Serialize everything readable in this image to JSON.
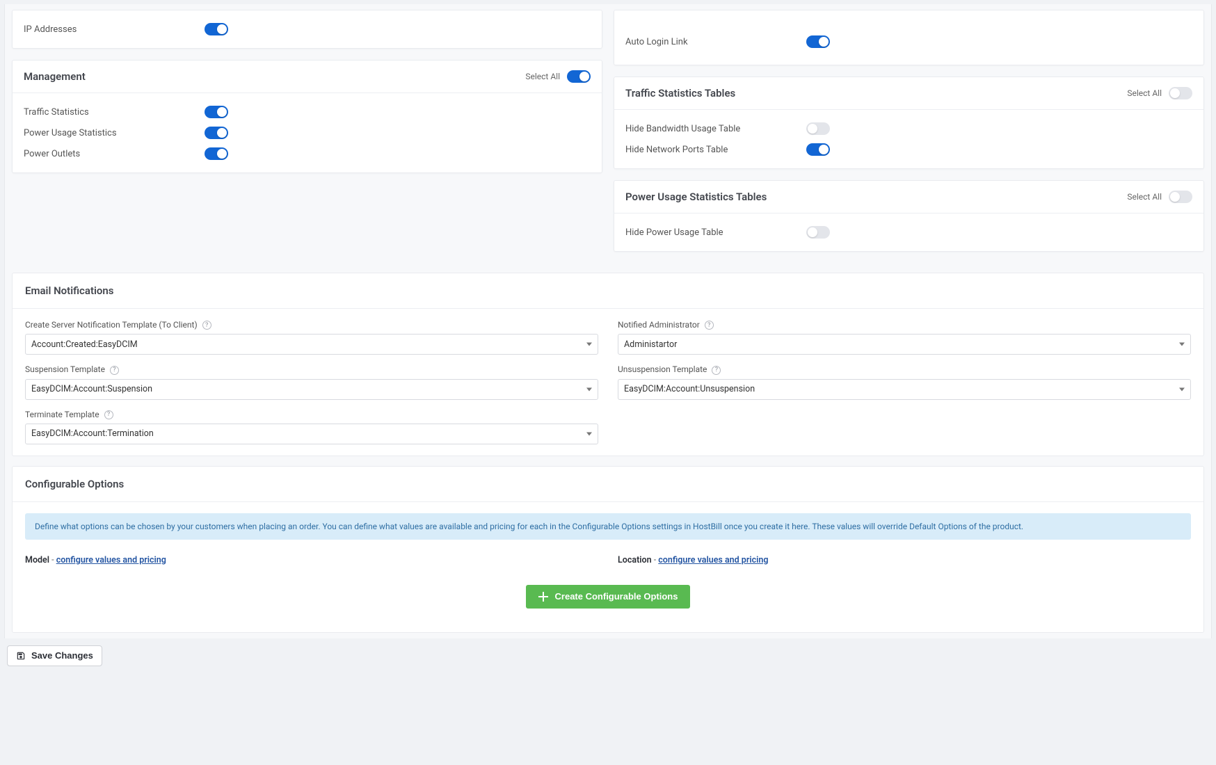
{
  "left": {
    "ipAddressesCard": {
      "items": [
        {
          "label": "IP Addresses",
          "on": true
        }
      ]
    },
    "managementCard": {
      "title": "Management",
      "selectAllLabel": "Select All",
      "selectAllOn": true,
      "items": [
        {
          "label": "Traffic Statistics",
          "on": true
        },
        {
          "label": "Power Usage Statistics",
          "on": true
        },
        {
          "label": "Power Outlets",
          "on": true
        }
      ]
    }
  },
  "right": {
    "autoLoginCard": {
      "items": [
        {
          "label": "Auto Login Link",
          "on": true
        }
      ]
    },
    "trafficCard": {
      "title": "Traffic Statistics Tables",
      "selectAllLabel": "Select All",
      "selectAllOn": false,
      "items": [
        {
          "label": "Hide Bandwidth Usage Table",
          "on": false
        },
        {
          "label": "Hide Network Ports Table",
          "on": true
        }
      ]
    },
    "powerCard": {
      "title": "Power Usage Statistics Tables",
      "selectAllLabel": "Select All",
      "selectAllOn": false,
      "items": [
        {
          "label": "Hide Power Usage Table",
          "on": false
        }
      ]
    }
  },
  "email": {
    "title": "Email Notifications",
    "fields": {
      "createTemplate": {
        "label": "Create Server Notification Template (To Client)",
        "value": "Account:Created:EasyDCIM"
      },
      "notifiedAdmin": {
        "label": "Notified Administrator",
        "value": "Administartor"
      },
      "suspension": {
        "label": "Suspension Template",
        "value": "EasyDCIM:Account:Suspension"
      },
      "unsuspension": {
        "label": "Unsuspension Template",
        "value": "EasyDCIM:Account:Unsuspension"
      },
      "terminate": {
        "label": "Terminate Template",
        "value": "EasyDCIM:Account:Termination"
      }
    }
  },
  "configurable": {
    "title": "Configurable Options",
    "banner": "Define what options can be chosen by your customers when placing an order. You can define what values are available and pricing for each in the Configurable Options settings in HostBill once you create it here. These values will override Default Options of the product.",
    "rows": [
      {
        "key": "Model",
        "linkText": "configure values and pricing"
      },
      {
        "key": "Location",
        "linkText": "configure values and pricing"
      }
    ],
    "createBtn": "Create Configurable Options"
  },
  "footer": {
    "save": "Save Changes"
  },
  "helpGlyph": "?"
}
